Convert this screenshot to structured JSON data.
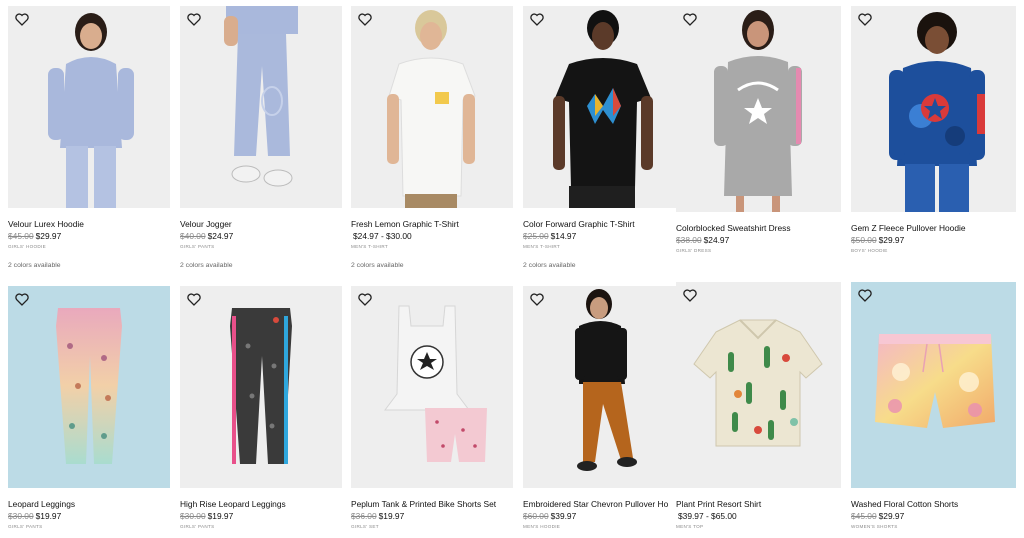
{
  "products": [
    {
      "name": "Velour Lurex Hoodie",
      "old_price": "$45.00",
      "price": "$29.97",
      "category": "GIRLS' HOODIE",
      "colors": "2 colors available",
      "bg": "#eeeeee",
      "garment": "#a9b8dc",
      "skin": "#d9ad8e",
      "hair": "#2a1d17",
      "icon": "heart-outline-icon"
    },
    {
      "name": "Velour Jogger",
      "old_price": "$40.00",
      "price": "$24.97",
      "category": "GIRLS' PANTS",
      "colors": "2 colors available",
      "bg": "#eeeeee",
      "garment": "#aab9dc",
      "skin": "#d9ad8e",
      "hair": "#2a1d17",
      "icon": "heart-outline-icon"
    },
    {
      "name": "Fresh Lemon Graphic T-Shirt",
      "old_price": "",
      "price": "$24.97 - $30.00",
      "category": "MEN'S T-SHIRT",
      "colors": "2 colors available",
      "bg": "#eeeeee",
      "garment": "#f7f7f5",
      "skin": "#e0b696",
      "hair": "#d9c89a",
      "icon": "heart-outline-icon"
    },
    {
      "name": "Color Forward Graphic T-Shirt",
      "old_price": "$25.00",
      "price": "$14.97",
      "category": "MEN'S T-SHIRT",
      "colors": "2 colors available",
      "bg": "#eeeeee",
      "garment": "#141414",
      "skin": "#5b3a29",
      "hair": "#111111",
      "icon": "heart-outline-icon"
    },
    {
      "name": "Colorblocked Sweatshirt Dress",
      "old_price": "$38.00",
      "price": "$24.97",
      "category": "GIRLS' DRESS",
      "colors": "",
      "bg": "#eeeeee",
      "garment": "#a9a9a9",
      "skin": "#c9957a",
      "hair": "#2a1d17",
      "icon": "heart-outline-icon"
    },
    {
      "name": "Gem Z Fleece Pullover Hoodie",
      "old_price": "$50.00",
      "price": "$29.97",
      "category": "BOYS' HOODIE",
      "colors": "",
      "bg": "#eeeeee",
      "garment": "#1d4f9c",
      "skin": "#7a4e35",
      "hair": "#1a120d",
      "icon": "heart-outline-icon"
    },
    {
      "name": "Leopard Leggings",
      "old_price": "$30.00",
      "price": "$19.97",
      "category": "GIRLS' PANTS",
      "colors": "",
      "bg": "#bcdbe6",
      "garment": "#e7a6b9",
      "skin": "",
      "hair": "",
      "icon": "heart-outline-icon"
    },
    {
      "name": "High Rise Leopard Leggings",
      "old_price": "$30.00",
      "price": "$19.97",
      "category": "GIRLS' PANTS",
      "colors": "",
      "bg": "#eeeeee",
      "garment": "#3a3a3a",
      "skin": "",
      "hair": "",
      "icon": "heart-outline-icon"
    },
    {
      "name": "Peplum Tank & Printed Bike Shorts Set",
      "old_price": "$36.00",
      "price": "$19.97",
      "category": "GIRLS' SET",
      "colors": "",
      "bg": "#eeeeee",
      "garment": "#f4f4f4",
      "skin": "",
      "hair": "",
      "icon": "heart-outline-icon"
    },
    {
      "name": "Embroidered Star Chevron Pullover Ho",
      "old_price": "$60.00",
      "price": "$39.97",
      "category": "MEN'S HOODIE",
      "colors": "",
      "bg": "#eeeeee",
      "garment": "#151515",
      "skin": "#c89c7f",
      "hair": "#1c1410",
      "icon": "heart-outline-icon"
    },
    {
      "name": "Plant Print Resort Shirt",
      "old_price": "",
      "price": "$39.97 - $65.00",
      "category": "MEN'S TOP",
      "colors": "",
      "bg": "#eeeeee",
      "garment": "#ece6d2",
      "skin": "",
      "hair": "",
      "icon": "heart-outline-icon"
    },
    {
      "name": "Washed Floral Cotton Shorts",
      "old_price": "$45.00",
      "price": "$29.97",
      "category": "WOMEN'S SHORTS",
      "colors": "",
      "bg": "#bcdbe6",
      "garment": "#f1c27a",
      "skin": "",
      "hair": "",
      "icon": "heart-outline-icon"
    }
  ]
}
